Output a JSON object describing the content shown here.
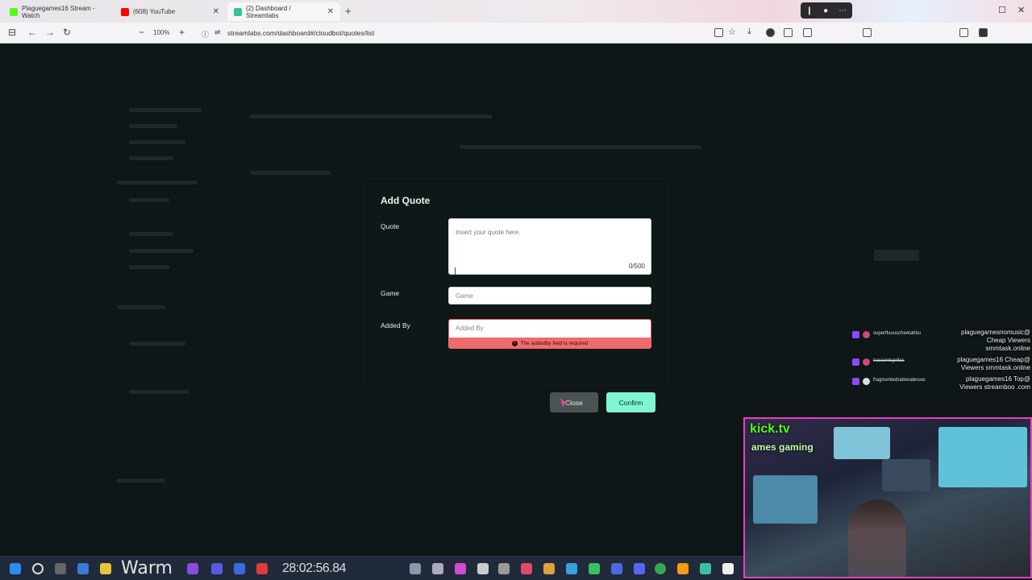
{
  "browser": {
    "tabs": [
      {
        "label": "Plaguegames16 Stream - Watch",
        "color": "#53fc18"
      },
      {
        "label": "(608) YouTube",
        "color": "#ff0000"
      },
      {
        "label": "(2) Dashboard / Streamlabs",
        "color": "#31c3a2"
      }
    ],
    "new_tab": "+",
    "zoom": "100%",
    "url": "streamlabs.com/dashboard#/cloudbot/quotes/list"
  },
  "modal": {
    "title": "Add Quote",
    "quote_label": "Quote",
    "quote_placeholder": "Insert your quote here.",
    "quote_counter": "0/500",
    "game_label": "Game",
    "game_placeholder": "Game",
    "added_by_label": "Added By",
    "added_by_placeholder": "Added By",
    "added_by_error": "The addedby field is required",
    "close_label": "Close",
    "confirm_label": "Confirm"
  },
  "chat": [
    {
      "user": "superfluouscheetahbu",
      "message": "plaguegamesnomusic@ Cheap Viewers smmtask.online"
    },
    {
      "user": "irascentsprites",
      "message": "plaguegames16 Cheap@ Viewers smmtask.online"
    },
    {
      "user": "fragmentedrationaleruoc",
      "message": "plaguegames16 Top@ Viewers streamboo .com"
    }
  ],
  "webcam": {
    "kick_text": "kick.tv",
    "games_text": "ames gaming"
  },
  "taskbar": {
    "weather": "Warm",
    "clock": "28:02:56.84"
  }
}
